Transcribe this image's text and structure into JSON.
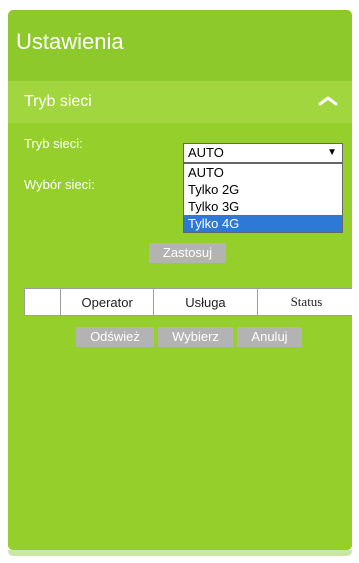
{
  "panel": {
    "title": "Ustawienia"
  },
  "section": {
    "title": "Tryb sieci",
    "collapse_icon": "chevron-up-icon"
  },
  "form": {
    "network_mode_label": "Tryb sieci:",
    "network_select_label": "Wybór sieci:",
    "select": {
      "value": "AUTO",
      "options": [
        "AUTO",
        "Tylko 2G",
        "Tylko 3G",
        "Tylko 4G"
      ],
      "highlighted": "Tylko 4G"
    },
    "apply_button": "Zastosuj"
  },
  "table": {
    "headers": [
      "",
      "Operator",
      "Usługa",
      "Status"
    ]
  },
  "buttons": {
    "refresh": "Odśwież",
    "select": "Wybierz",
    "cancel": "Anuluj"
  },
  "colors": {
    "panel_green": "#8ec92b",
    "header_green": "#a2d63f",
    "button_gray": "#b3b3b3",
    "option_highlight": "#2f79d6"
  }
}
